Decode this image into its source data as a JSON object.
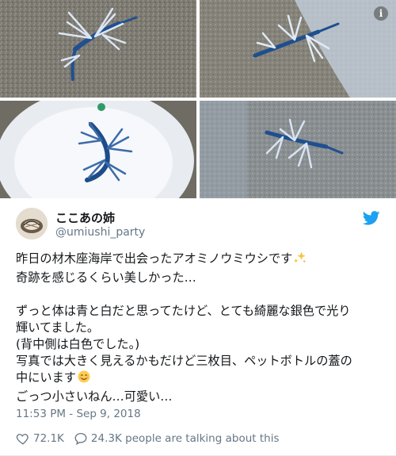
{
  "tweet": {
    "author": {
      "name": "ここあの姉",
      "handle": "@umiushi_party"
    },
    "body": {
      "paragraph1": [
        "昨日の材木座海岸で出会ったアオミノウミウシです",
        "奇跡を感じるくらい美しかった…"
      ],
      "paragraph2": [
        "ずっと体は青と白だと思ってたけど、とても綺麗な銀色で光り",
        "輝いてました。",
        "(背中側は白色でした。)",
        "写真では大きく見えるかもだけど三枚目、ペットボトルの蓋の",
        "中にいます",
        "ごっつ小さいねん…可愛い…"
      ]
    },
    "timestamp": "11:53 PM - Sep 9, 2018",
    "likes": "72.1K",
    "conversation": "24.3K people are talking about this",
    "info_glyph": "i"
  },
  "icons": [
    "info-icon",
    "twitter-bird-icon",
    "sparkles-emoji",
    "smiling-face-emoji",
    "heart-icon",
    "comment-bubble-icon"
  ],
  "colors": {
    "twitter_blue": "#1da1f2",
    "secondary_text": "#657786",
    "primary_text": "#14171a",
    "slug_blue": "#1f4f8f"
  }
}
